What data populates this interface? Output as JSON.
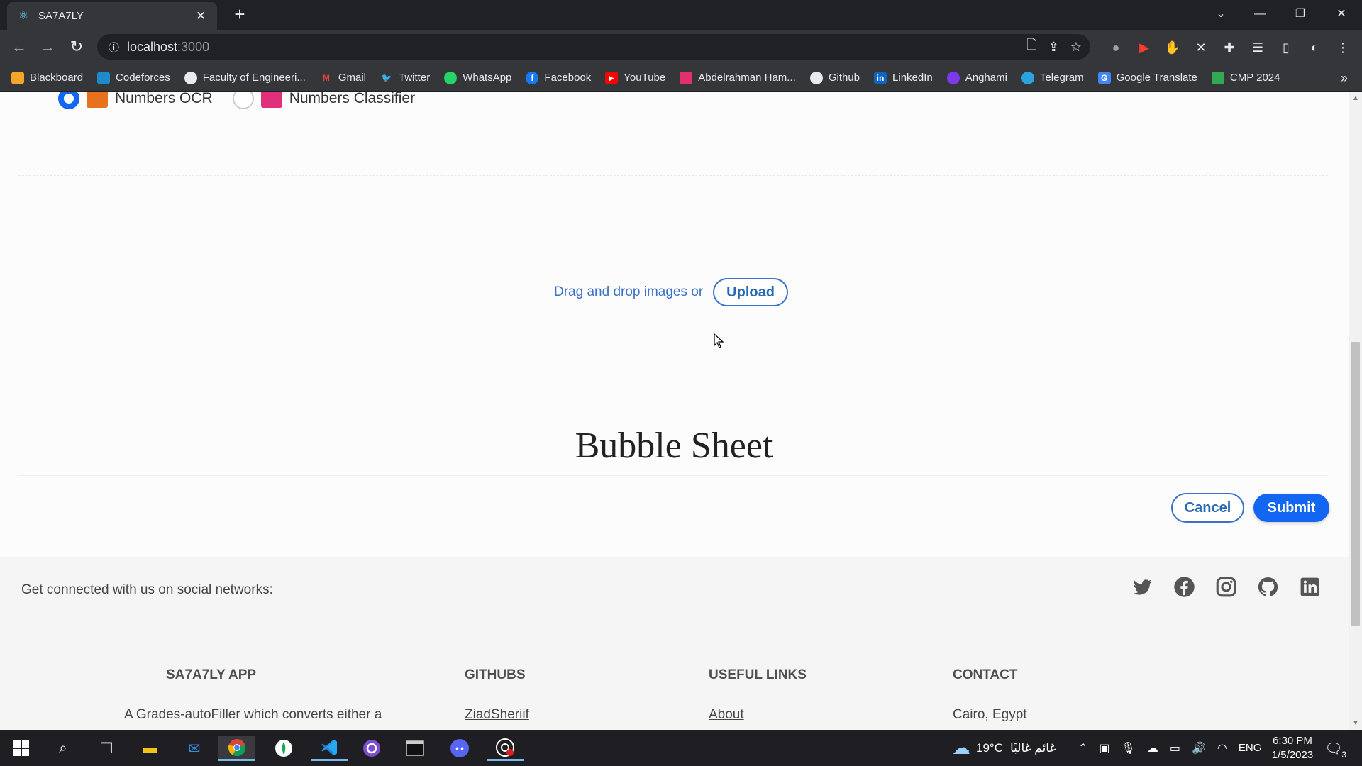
{
  "browser": {
    "tab_title": "SA7A7LY",
    "url_host": "localhost",
    "url_port": ":3000",
    "bookmarks": [
      {
        "label": "Blackboard",
        "color": "#f4a62a"
      },
      {
        "label": "Codeforces",
        "color": "#1f8acb"
      },
      {
        "label": "Faculty of Engineeri...",
        "color": "#ffffff"
      },
      {
        "label": "Gmail",
        "color": "#ea4335"
      },
      {
        "label": "Twitter",
        "color": "#1da1f2"
      },
      {
        "label": "WhatsApp",
        "color": "#25d366"
      },
      {
        "label": "Facebook",
        "color": "#1877f2"
      },
      {
        "label": "YouTube",
        "color": "#ff0000"
      },
      {
        "label": "Abdelrahman Ham...",
        "color": "#e1306c"
      },
      {
        "label": "Github",
        "color": "#ffffff"
      },
      {
        "label": "LinkedIn",
        "color": "#0a66c2"
      },
      {
        "label": "Anghami",
        "color": "#7c3aed"
      },
      {
        "label": "Telegram",
        "color": "#2aa3df"
      },
      {
        "label": "Google Translate",
        "color": "#4285f4"
      },
      {
        "label": "CMP 2024",
        "color": "#34a853"
      }
    ]
  },
  "options": {
    "ocr_label": "Numbers OCR",
    "classifier_label": "Numbers Classifier",
    "selected": "Numbers OCR"
  },
  "dropzone": {
    "text": "Drag and drop images or",
    "upload_label": "Upload"
  },
  "sheet_title": "Bubble Sheet",
  "actions": {
    "cancel_label": "Cancel",
    "submit_label": "Submit"
  },
  "footer": {
    "social_text": "Get connected with us on social networks:",
    "social_icons": [
      "twitter-icon",
      "facebook-icon",
      "instagram-icon",
      "github-icon",
      "linkedin-icon"
    ],
    "columns": [
      {
        "heading": "SA7A7LY APP",
        "text": "A Grades-autoFiller which converts either a"
      },
      {
        "heading": "GITHUBS",
        "link": "ZiadSheriif"
      },
      {
        "heading": "USEFUL LINKS",
        "link": "About"
      },
      {
        "heading": "CONTACT",
        "text": "Cairo, Egypt"
      }
    ]
  },
  "taskbar": {
    "weather": "19°C",
    "weather_text": "غائم غالبًا",
    "language": "ENG",
    "time": "6:30 PM",
    "date": "1/5/2023",
    "notifications": "3"
  },
  "colors": {
    "primary": "#1266f1",
    "accent": "#3b71ca",
    "footer_bg": "#f5f5f5"
  }
}
